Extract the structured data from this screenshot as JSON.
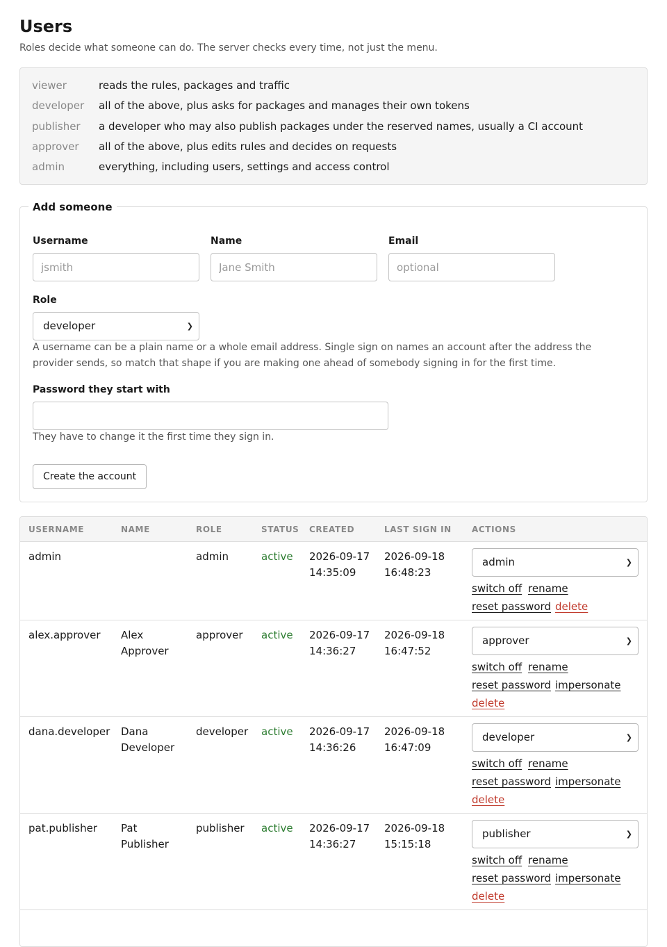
{
  "header": {
    "title": "Users",
    "subtitle": "Roles decide what someone can do. The server checks every time, not just the menu."
  },
  "roles": [
    {
      "name": "viewer",
      "desc": "reads the rules, packages and traffic"
    },
    {
      "name": "developer",
      "desc": "all of the above, plus asks for packages and manages their own tokens"
    },
    {
      "name": "publisher",
      "desc": "a developer who may also publish packages under the reserved names, usually a CI account"
    },
    {
      "name": "approver",
      "desc": "all of the above, plus edits rules and decides on requests"
    },
    {
      "name": "admin",
      "desc": "everything, including users, settings and access control"
    }
  ],
  "add_form": {
    "legend": "Add someone",
    "username_label": "Username",
    "username_placeholder": "jsmith",
    "name_label": "Name",
    "name_placeholder": "Jane Smith",
    "email_label": "Email",
    "email_placeholder": "optional",
    "role_label": "Role",
    "role_value": "developer",
    "role_hint": "A username can be a plain name or a whole email address. Single sign on names an account after the address the provider sends, so match that shape if you are making one ahead of somebody signing in for the first time.",
    "password_label": "Password they start with",
    "password_value": "",
    "password_hint": "They have to change it the first time they sign in.",
    "submit_label": "Create the account"
  },
  "table": {
    "columns": [
      "USERNAME",
      "NAME",
      "ROLE",
      "STATUS",
      "CREATED",
      "LAST SIGN IN",
      "ACTIONS"
    ],
    "action_labels": {
      "switch_off": "switch off",
      "rename": "rename",
      "reset_password": "reset password",
      "impersonate": "impersonate",
      "delete": "delete"
    },
    "rows": [
      {
        "username": "admin",
        "name_first": "",
        "name_last": "",
        "role": "admin",
        "status": "active",
        "created_date": "2026-09-17",
        "created_time": "14:35:09",
        "last_date": "2026-09-18",
        "last_time": "16:48:23",
        "role_select": "admin"
      },
      {
        "username": "alex.approver",
        "name_first": "Alex",
        "name_last": "Approver",
        "role": "approver",
        "status": "active",
        "created_date": "2026-09-17",
        "created_time": "14:36:27",
        "last_date": "2026-09-18",
        "last_time": "16:47:52",
        "role_select": "approver"
      },
      {
        "username": "dana.developer",
        "name_first": "Dana",
        "name_last": "Developer",
        "role": "developer",
        "status": "active",
        "created_date": "2026-09-17",
        "created_time": "14:36:26",
        "last_date": "2026-09-18",
        "last_time": "16:47:09",
        "role_select": "developer"
      },
      {
        "username": "pat.publisher",
        "name_first": "Pat",
        "name_last": "Publisher",
        "role": "publisher",
        "status": "active",
        "created_date": "2026-09-17",
        "created_time": "14:36:27",
        "last_date": "2026-09-18",
        "last_time": "15:15:18",
        "role_select": "publisher"
      }
    ]
  },
  "icons": {
    "select_arrow": "chevron-down-icon"
  },
  "colors": {
    "status_active": "#2e7d32",
    "danger": "#c0392b",
    "muted": "#888888"
  }
}
